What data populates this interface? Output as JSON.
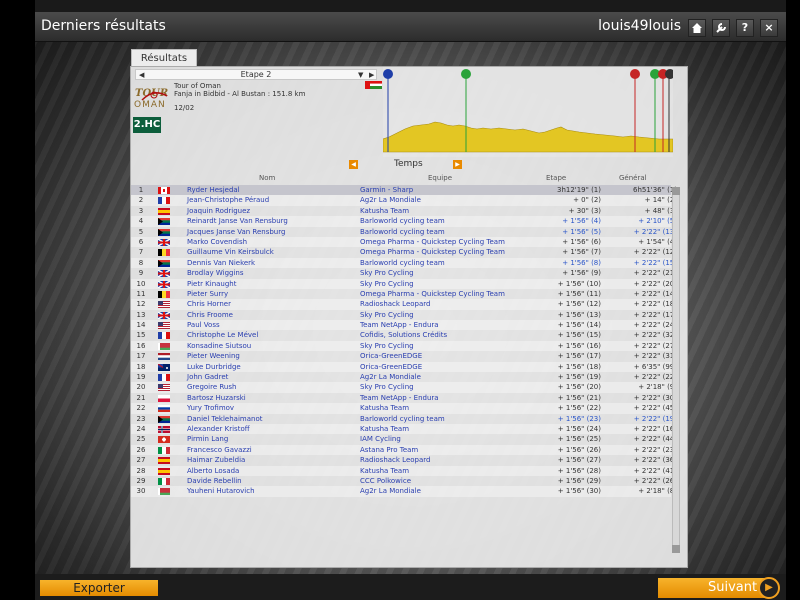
{
  "window": {
    "title": "Derniers résultats",
    "username": "louis49louis",
    "buttons": [
      "home-icon",
      "wrench-icon",
      "help-icon",
      "close-icon"
    ],
    "help_label": "?",
    "close_label": "×"
  },
  "panel": {
    "tab_label": "Résultats",
    "stage_select": "Etape 2",
    "race_name": "Tour of Oman",
    "route": "Fanja in Bidbid - Al Bustan : 151.8 km",
    "date": "12/02",
    "logo_text": "OMAN",
    "category": "2.HC",
    "sort_label": "Temps",
    "columns": {
      "name": "Nom",
      "team": "Equipe",
      "stage": "Etape",
      "general": "Général"
    }
  },
  "results": [
    {
      "pos": "1",
      "flag": "CAN",
      "name": "Ryder Hesjedal",
      "team": "Garmin - Sharp",
      "stage": "3h12'19\" (1)",
      "gen": "6h51'36\" (1)",
      "sb": false,
      "gb": false
    },
    {
      "pos": "2",
      "flag": "FRA",
      "name": "Jean-Christophe Péraud",
      "team": "Ag2r La Mondiale",
      "stage": "+ 0\" (2)",
      "gen": "+ 14\" (2)",
      "sb": false,
      "gb": false
    },
    {
      "pos": "3",
      "flag": "ESP",
      "name": "Joaquin Rodriguez",
      "team": "Katusha Team",
      "stage": "+ 30\" (3)",
      "gen": "+ 48\" (3)",
      "sb": false,
      "gb": false
    },
    {
      "pos": "4",
      "flag": "RSA",
      "name": "Reinardt Janse Van Rensburg",
      "team": "Barloworld cycling team",
      "stage": "+ 1'56\" (4)",
      "gen": "+ 2'10\" (5)",
      "sb": true,
      "gb": true
    },
    {
      "pos": "5",
      "flag": "RSA",
      "name": "Jacques Janse Van Rensburg",
      "team": "Barloworld cycling team",
      "stage": "+ 1'56\" (5)",
      "gen": "+ 2'22\" (13)",
      "sb": true,
      "gb": true
    },
    {
      "pos": "6",
      "flag": "GBR",
      "name": "Marko Covendish",
      "team": "Omega Pharma - Quickstep Cycling Team",
      "stage": "+ 1'56\" (6)",
      "gen": "+ 1'54\" (4)",
      "sb": false,
      "gb": false
    },
    {
      "pos": "7",
      "flag": "BEL",
      "name": "Guillaume Vin Keirsbulck",
      "team": "Omega Pharma - Quickstep Cycling Team",
      "stage": "+ 1'56\" (7)",
      "gen": "+ 2'22\" (12)",
      "sb": false,
      "gb": false
    },
    {
      "pos": "8",
      "flag": "RSA",
      "name": "Dennis Van Niekerk",
      "team": "Barloworld cycling team",
      "stage": "+ 1'56\" (8)",
      "gen": "+ 2'22\" (15)",
      "sb": true,
      "gb": true
    },
    {
      "pos": "9",
      "flag": "GBR",
      "name": "Brodlay Wiggins",
      "team": "Sky Pro Cycling",
      "stage": "+ 1'56\" (9)",
      "gen": "+ 2'22\" (21)",
      "sb": false,
      "gb": false
    },
    {
      "pos": "10",
      "flag": "GBR",
      "name": "Pietr Kinaught",
      "team": "Sky Pro Cycling",
      "stage": "+ 1'56\" (10)",
      "gen": "+ 2'22\" (20)",
      "sb": false,
      "gb": false
    },
    {
      "pos": "11",
      "flag": "BEL",
      "name": "Pieter Surry",
      "team": "Omega Pharma - Quickstep Cycling Team",
      "stage": "+ 1'56\" (11)",
      "gen": "+ 2'22\" (14)",
      "sb": false,
      "gb": false
    },
    {
      "pos": "12",
      "flag": "USA",
      "name": "Chris Horner",
      "team": "Radioshack Leopard",
      "stage": "+ 1'56\" (12)",
      "gen": "+ 2'22\" (18)",
      "sb": false,
      "gb": false
    },
    {
      "pos": "13",
      "flag": "GBR",
      "name": "Chris Froome",
      "team": "Sky Pro Cycling",
      "stage": "+ 1'56\" (13)",
      "gen": "+ 2'22\" (17)",
      "sb": false,
      "gb": false
    },
    {
      "pos": "14",
      "flag": "USA",
      "name": "Paul Voss",
      "team": "Team NetApp - Endura",
      "stage": "+ 1'56\" (14)",
      "gen": "+ 2'22\" (24)",
      "sb": false,
      "gb": false
    },
    {
      "pos": "15",
      "flag": "FRA",
      "name": "Christophe Le Mével",
      "team": "Cofidis, Solutions Crédits",
      "stage": "+ 1'56\" (15)",
      "gen": "+ 2'22\" (32)",
      "sb": false,
      "gb": false
    },
    {
      "pos": "16",
      "flag": "BLR",
      "name": "Konsadine Siutsou",
      "team": "Sky Pro Cycling",
      "stage": "+ 1'56\" (16)",
      "gen": "+ 2'22\" (27)",
      "sb": false,
      "gb": false
    },
    {
      "pos": "17",
      "flag": "NED",
      "name": "Pieter Weening",
      "team": "Orica-GreenEDGE",
      "stage": "+ 1'56\" (17)",
      "gen": "+ 2'22\" (31)",
      "sb": false,
      "gb": false
    },
    {
      "pos": "18",
      "flag": "AUS",
      "name": "Luke Durbridge",
      "team": "Orica-GreenEDGE",
      "stage": "+ 1'56\" (18)",
      "gen": "+ 6'35\" (99)",
      "sb": false,
      "gb": false
    },
    {
      "pos": "19",
      "flag": "FRA",
      "name": "John Gadret",
      "team": "Ag2r La Mondiale",
      "stage": "+ 1'56\" (19)",
      "gen": "+ 2'22\" (22)",
      "sb": false,
      "gb": false
    },
    {
      "pos": "20",
      "flag": "USA",
      "name": "Gregoire Rush",
      "team": "Sky Pro Cycling",
      "stage": "+ 1'56\" (20)",
      "gen": "+ 2'18\" (9)",
      "sb": false,
      "gb": false
    },
    {
      "pos": "21",
      "flag": "POL",
      "name": "Bartosz Huzarski",
      "team": "Team NetApp - Endura",
      "stage": "+ 1'56\" (21)",
      "gen": "+ 2'22\" (30)",
      "sb": false,
      "gb": false
    },
    {
      "pos": "22",
      "flag": "RUS",
      "name": "Yury Trofimov",
      "team": "Katusha Team",
      "stage": "+ 1'56\" (22)",
      "gen": "+ 2'22\" (45)",
      "sb": false,
      "gb": false
    },
    {
      "pos": "23",
      "flag": "RSA",
      "name": "Daniel Teklehaimanot",
      "team": "Barloworld cycling team",
      "stage": "+ 1'56\" (23)",
      "gen": "+ 2'22\" (19)",
      "sb": true,
      "gb": true
    },
    {
      "pos": "24",
      "flag": "NOR",
      "name": "Alexander Kristoff",
      "team": "Katusha Team",
      "stage": "+ 1'56\" (24)",
      "gen": "+ 2'22\" (16)",
      "sb": false,
      "gb": false
    },
    {
      "pos": "25",
      "flag": "SUI",
      "name": "Pirmin Lang",
      "team": "IAM Cycling",
      "stage": "+ 1'56\" (25)",
      "gen": "+ 2'22\" (44)",
      "sb": false,
      "gb": false
    },
    {
      "pos": "26",
      "flag": "ITA",
      "name": "Francesco Gavazzi",
      "team": "Astana Pro Team",
      "stage": "+ 1'56\" (26)",
      "gen": "+ 2'22\" (23)",
      "sb": false,
      "gb": false
    },
    {
      "pos": "27",
      "flag": "ESP",
      "name": "Haimar Zubeldia",
      "team": "Radioshack Leopard",
      "stage": "+ 1'56\" (27)",
      "gen": "+ 2'22\" (36)",
      "sb": false,
      "gb": false
    },
    {
      "pos": "28",
      "flag": "ESP",
      "name": "Alberto Losada",
      "team": "Katusha Team",
      "stage": "+ 1'56\" (28)",
      "gen": "+ 2'22\" (41)",
      "sb": false,
      "gb": false
    },
    {
      "pos": "29",
      "flag": "ITA",
      "name": "Davide Rebellin",
      "team": "CCC Polkowice",
      "stage": "+ 1'56\" (29)",
      "gen": "+ 2'22\" (26)",
      "sb": false,
      "gb": false
    },
    {
      "pos": "30",
      "flag": "BLR",
      "name": "Yauheni Hutarovich",
      "team": "Ag2r La Mondiale",
      "stage": "+ 1'56\" (30)",
      "gen": "+ 2'18\" (8)",
      "sb": false,
      "gb": false
    }
  ],
  "footer": {
    "export_label": "Exporter",
    "next_label": "Suivant"
  },
  "profile_markers": [
    {
      "label": "start-marker",
      "color": "#1f3ea8",
      "glyph": "▶"
    },
    {
      "label": "sprint-marker",
      "color": "#2aa33a",
      "glyph": "S"
    },
    {
      "label": "climb-marker",
      "color": "#c52525",
      "glyph": "3"
    },
    {
      "label": "sprint-marker",
      "color": "#2aa33a",
      "glyph": "S"
    },
    {
      "label": "climb-marker",
      "color": "#c52525",
      "glyph": "3"
    },
    {
      "label": "finish-marker",
      "color": "#333333",
      "glyph": "▦"
    }
  ],
  "colors": {
    "accent": "#e98a00",
    "link": "#2a3fb0",
    "badge": "#0d5e3c"
  }
}
